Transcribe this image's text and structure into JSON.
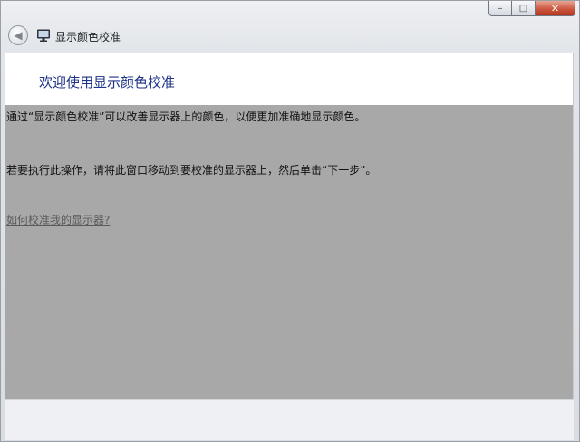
{
  "window": {
    "title": "显示颜色校准",
    "caption": {
      "minimize": "–",
      "maximize": "□",
      "close": "✕"
    },
    "back_icon": "back-arrow-icon",
    "app_icon": "monitor-icon"
  },
  "page": {
    "main_instruction": "欢迎使用显示颜色校准",
    "paragraph1": "通过“显示颜色校准”可以改善显示器上的颜色，以便更加准确地显示颜色。",
    "paragraph2": "若要执行此操作，请将此窗口移动到要校准的显示器上，然后单击“下一步”。",
    "help_link": "如何校准我的显示器?"
  },
  "colors": {
    "content_bg": "#a8a8a8",
    "header_bg": "#ffffff",
    "instruction_text": "#1e3287",
    "close_button": "#c9533a"
  }
}
